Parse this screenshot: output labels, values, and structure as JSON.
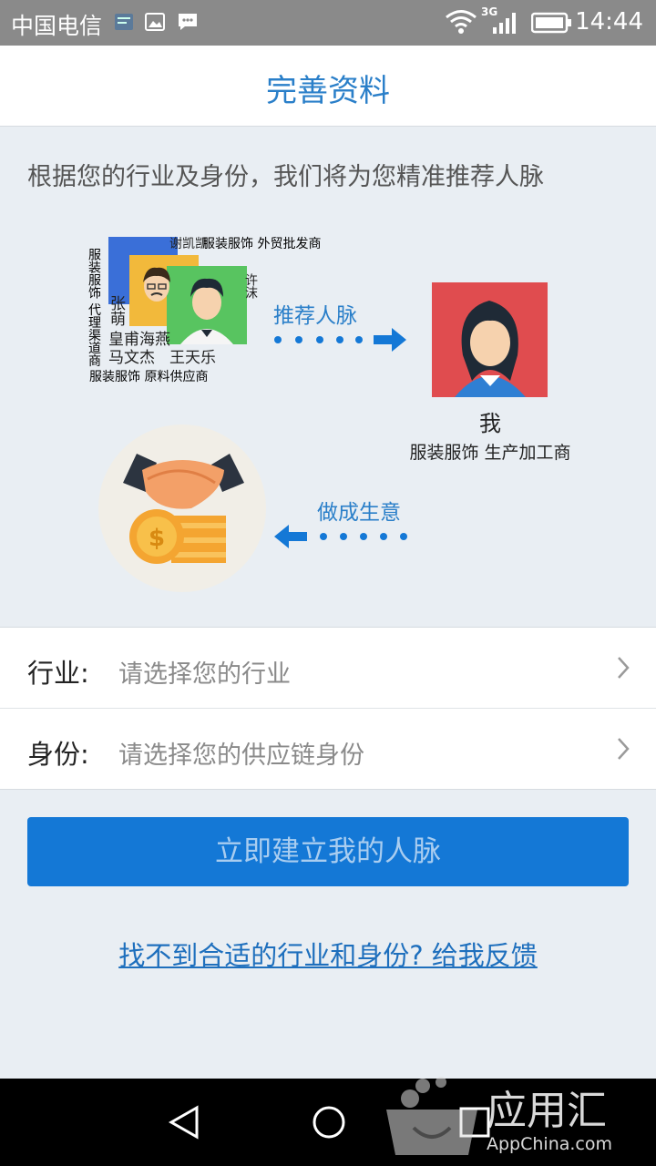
{
  "status_bar": {
    "carrier": "中国电信",
    "network": "3G",
    "time": "14:44"
  },
  "header": {
    "title": "完善资料"
  },
  "intro": "根据您的行业及身份，我们将为您精准推荐人脉",
  "illustration": {
    "contacts": [
      {
        "name": "张萌",
        "tag": "服装服饰 代理渠道商",
        "color": "#3a6fd8"
      },
      {
        "name": "皇甫海燕",
        "tag": "",
        "color": "#f2b93b"
      },
      {
        "name": "马文杰",
        "tag": "服装服饰 原料供应商",
        "color": "#58c460"
      },
      {
        "name": "谢凯凯",
        "tag": "服装服饰 外贸批发商",
        "color": ""
      },
      {
        "name": "王天乐",
        "tag": "",
        "color": ""
      },
      {
        "name": "许沫",
        "tag": "",
        "color": ""
      }
    ],
    "recommend_label": "推荐人脉",
    "me_name": "我",
    "me_tag": "服装服饰 生产加工商",
    "deal_label": "做成生意",
    "accent": "#1478d6"
  },
  "form": {
    "industry": {
      "label": "行业:",
      "placeholder": "请选择您的行业"
    },
    "identity": {
      "label": "身份:",
      "placeholder": "请选择您的供应链身份"
    }
  },
  "submit_button": "立即建立我的人脉",
  "feedback_link": "找不到合适的行业和身份? 给我反馈",
  "watermark": {
    "brand": "应用汇",
    "site": "AppChina.com"
  }
}
